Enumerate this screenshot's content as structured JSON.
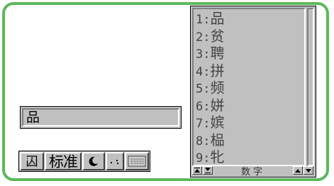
{
  "composition": {
    "input_text": "品"
  },
  "status_bar": {
    "ime_icon": "ime-logo-icon",
    "mode_label": "标准",
    "width_icon": "moon-icon",
    "punct_icon": "punctuation-icon",
    "keyboard_icon": "soft-keyboard-icon"
  },
  "candidates": {
    "items": [
      {
        "num": "1",
        "char": "品"
      },
      {
        "num": "2",
        "char": "贫"
      },
      {
        "num": "3",
        "char": "聘"
      },
      {
        "num": "4",
        "char": "拼"
      },
      {
        "num": "5",
        "char": "频"
      },
      {
        "num": "6",
        "char": "姘"
      },
      {
        "num": "7",
        "char": "嫔"
      },
      {
        "num": "8",
        "char": "榀"
      },
      {
        "num": "9",
        "char": "牝"
      }
    ],
    "separator": ":",
    "footer_label": "数字"
  },
  "colors": {
    "frame_border": "#5cb85a",
    "panel_bg": "#c0c0c0"
  }
}
